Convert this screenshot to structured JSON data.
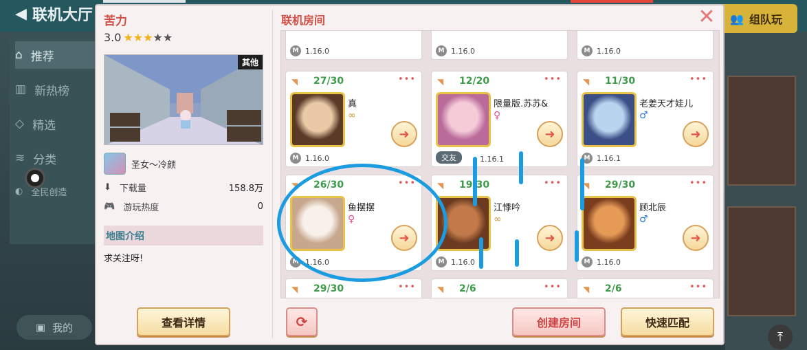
{
  "background": {
    "title": "联机大厅",
    "nav": [
      "推荐",
      "新热榜",
      "精选",
      "分类",
      "全民创造"
    ],
    "mine": "我的",
    "team_button": "组队玩"
  },
  "map": {
    "name": "苦力",
    "rating": "3.0",
    "stars": [
      1,
      1,
      1,
      0,
      0
    ],
    "tag": "其他",
    "author": "圣女～冷颜",
    "downloads_label": "下载量",
    "downloads_value": "158.8万",
    "heat_label": "游玩热度",
    "heat_value": "0",
    "intro_header": "地图介绍",
    "intro_text": "求关注呀!",
    "details_button": "查看详情"
  },
  "rooms": {
    "title": "联机房间",
    "top_versions": [
      "1.16.0",
      "1.16.0",
      "1.16.0"
    ],
    "row1": [
      {
        "count": "27/30",
        "name": "真",
        "gender": "∞",
        "gtype": "u",
        "version": "1.16.0",
        "friend": ""
      },
      {
        "count": "12/20",
        "name": "限量版.苏苏&",
        "gender": "♀",
        "gtype": "f",
        "version": "1.16.1",
        "friend": "交友"
      },
      {
        "count": "11/30",
        "name": "老姜天才娃儿",
        "gender": "♂",
        "gtype": "m",
        "version": "1.16.1",
        "friend": ""
      }
    ],
    "row2": [
      {
        "count": "26/30",
        "name": "鱼摆摆",
        "gender": "♀",
        "gtype": "f",
        "version": "1.16.0"
      },
      {
        "count": "19/30",
        "name": "江悸吟",
        "gender": "∞",
        "gtype": "u",
        "version": "1.16.0"
      },
      {
        "count": "29/30",
        "name": "顾北辰",
        "gender": "♂",
        "gtype": "m",
        "version": "1.16.0"
      }
    ],
    "row3": [
      {
        "count": "29/30"
      },
      {
        "count": "2/6"
      },
      {
        "count": "2/6"
      }
    ],
    "more": "•••",
    "create_button": "创建房间",
    "match_button": "快速匹配"
  }
}
